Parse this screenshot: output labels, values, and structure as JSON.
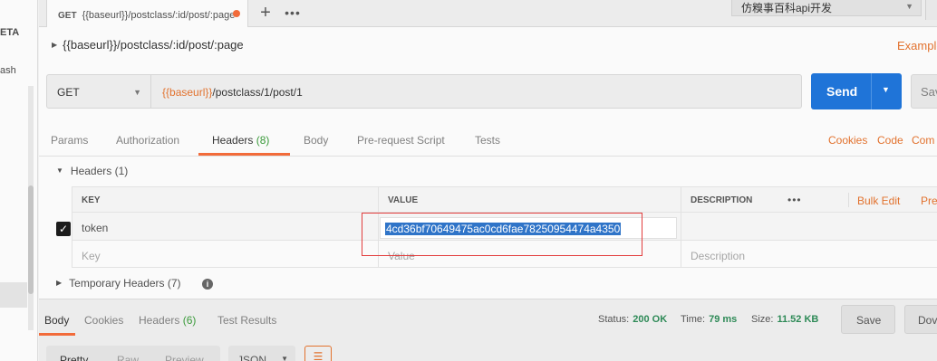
{
  "sidebar": {
    "items": [
      {
        "label": "ETA"
      },
      {
        "label": "ash"
      }
    ]
  },
  "tab": {
    "method": "GET",
    "title": "{{baseurl}}/postclass/:id/post/:page",
    "unsaved_color": "#f26b3a"
  },
  "tab_actions": {
    "add": "+",
    "more": "•••"
  },
  "environment": {
    "selected": "仿糗事百科api开发"
  },
  "request": {
    "title": "{{baseurl}}/postclass/:id/post/:page",
    "examples_label": "Example",
    "method": "GET",
    "url_var": "{{baseurl}}",
    "url_path": "/postclass/1/post/1",
    "send_label": "Send",
    "save_label": "Sav"
  },
  "request_tabs": [
    {
      "label": "Params"
    },
    {
      "label": "Authorization"
    },
    {
      "label": "Headers",
      "count": "(8)"
    },
    {
      "label": "Body"
    },
    {
      "label": "Pre-request Script"
    },
    {
      "label": "Tests"
    }
  ],
  "request_links": {
    "cookies": "Cookies",
    "code": "Code",
    "comments": "Com"
  },
  "headers": {
    "section_title": "Headers (1)",
    "columns": {
      "key": "KEY",
      "value": "VALUE",
      "description": "DESCRIPTION"
    },
    "more": "•••",
    "bulk_edit": "Bulk Edit",
    "presets": "Pre",
    "rows": [
      {
        "key": "token",
        "value": "4cd36bf70649475ac0cd6fae78250954474a4350",
        "description": "",
        "checked": true
      }
    ],
    "new_row": {
      "key_placeholder": "Key",
      "value_placeholder": "Value",
      "description_placeholder": "Description"
    },
    "temporary_title": "Temporary Headers (7)"
  },
  "response": {
    "tabs": [
      {
        "label": "Body"
      },
      {
        "label": "Cookies"
      },
      {
        "label": "Headers",
        "count": "(6)"
      },
      {
        "label": "Test Results"
      }
    ],
    "status_label": "Status:",
    "status_value": "200 OK",
    "time_label": "Time:",
    "time_value": "79 ms",
    "size_label": "Size:",
    "size_value": "11.52 KB",
    "save_label": "Save",
    "download_label": "Dov",
    "formats": [
      "Pretty",
      "Raw",
      "Preview"
    ],
    "language": "JSON"
  },
  "colors": {
    "accent": "#f26b3a",
    "link": "#e2722e",
    "primary": "#1f74d8",
    "success": "#2e8a57",
    "highlight_box": "#e23d3d"
  }
}
